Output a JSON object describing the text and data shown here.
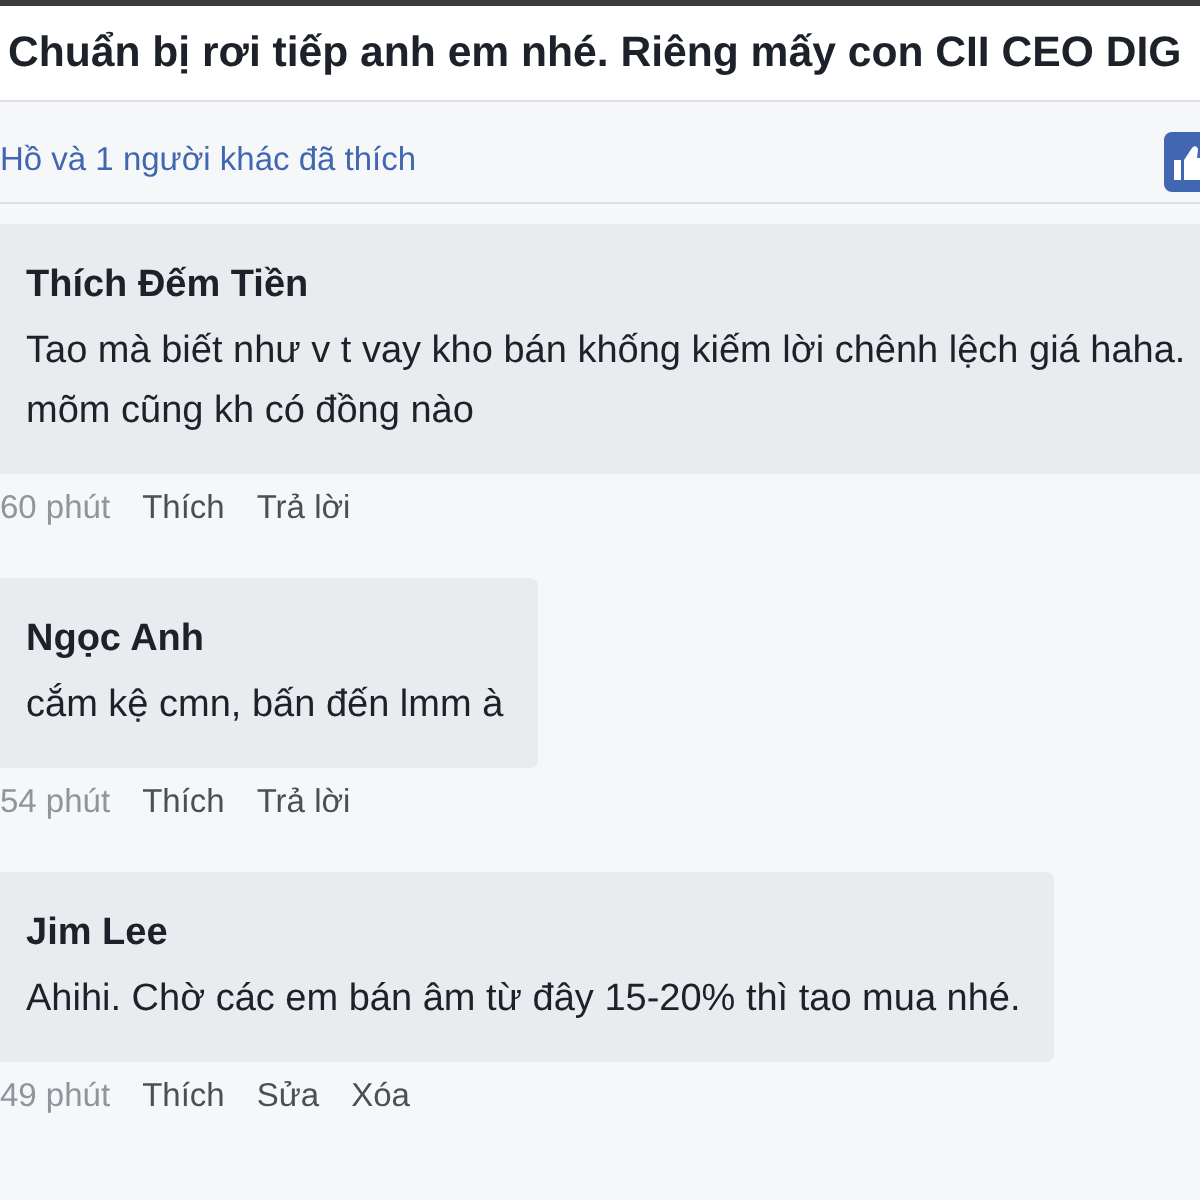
{
  "post": {
    "title": "Chuẩn bị rơi tiếp anh em nhé. Riêng mấy con CII CEO DIG"
  },
  "likes": {
    "text": "Hồ và 1 người khác đã thích"
  },
  "comments": [
    {
      "author": "Thích Đếm Tiền",
      "text": "Tao mà biết như v t vay kho bán khống kiếm lời chênh lệch giá haha.\nmõm cũng kh có đồng nào",
      "time": "60 phút",
      "actions": [
        "Thích",
        "Trả lời"
      ]
    },
    {
      "author": "Ngọc Anh",
      "text": "cắm kệ cmn, bấn đến lmm à",
      "time": "54 phút",
      "actions": [
        "Thích",
        "Trả lời"
      ]
    },
    {
      "author": "Jim Lee",
      "text": "Ahihi. Chờ các em bán âm từ đây 15-20% thì tao mua nhé.",
      "time": "49 phút",
      "actions": [
        "Thích",
        "Sửa",
        "Xóa"
      ]
    }
  ]
}
